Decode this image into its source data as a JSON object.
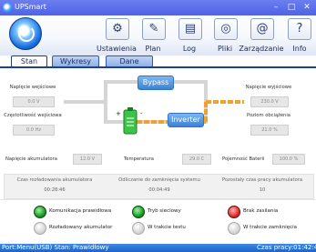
{
  "window": {
    "title": "UPSmart",
    "min": "–",
    "max": "□",
    "close": "✕"
  },
  "toolbar": {
    "items": [
      {
        "label": "Ustawienia",
        "icon": "settings-sliders-icon",
        "glyph": "⚙"
      },
      {
        "label": "Plan",
        "icon": "pencil-icon",
        "glyph": "✎"
      },
      {
        "label": "Log",
        "icon": "log-document-icon",
        "glyph": "▤"
      },
      {
        "label": "Pliki",
        "icon": "target-icon",
        "glyph": "◎"
      },
      {
        "label": "Zarządzanie",
        "icon": "at-icon",
        "glyph": "@"
      },
      {
        "label": "Info",
        "icon": "help-icon",
        "glyph": "?"
      }
    ]
  },
  "tabs": [
    {
      "label": "Stan",
      "active": true
    },
    {
      "label": "Wykresy",
      "active": false
    },
    {
      "label": "Dane",
      "active": false
    }
  ],
  "diagram": {
    "bypass": "Bypass",
    "inverter": "Inverter",
    "plus": "+",
    "minus": "-",
    "input_voltage_label": "Napięcie wejściowe",
    "input_voltage": "0.0 V",
    "input_freq_label": "Częstotliwość wejściowa",
    "input_freq": "0.0 Hz",
    "output_voltage_label": "Napięcie wyjściowe",
    "output_voltage": "230.0 V",
    "load_label": "Poziom obciążenia",
    "load": "21.0 %"
  },
  "battery": {
    "voltage_label": "Napięcie akumulatora",
    "voltage": "12.0 V",
    "temp_label": "Temperatura",
    "temp": "29.0 C",
    "capacity_label": "Pojemność Baterii",
    "capacity": "100.0 %"
  },
  "times": [
    {
      "label": "Czas rozładowania akumulatora",
      "value": "00:28:46"
    },
    {
      "label": "Odliczanie do zamknięcia systemu",
      "value": "00:04:49"
    },
    {
      "label": "Pozostały czas pracy akumulatora",
      "value": "10"
    }
  ],
  "indicators": [
    {
      "label": "Komunikacja prawidłowa",
      "state": "green"
    },
    {
      "label": "Tryb sieciowy",
      "state": "green"
    },
    {
      "label": "Brak zasilania",
      "state": "red"
    },
    {
      "label": "Rozładowany akumulator",
      "state": "gray"
    },
    {
      "label": "W trakcie testu",
      "state": "gray"
    },
    {
      "label": "W trakcie zamknięcia",
      "state": "gray"
    }
  ],
  "status": {
    "left": "Port:Menu(USB)  Stan: Prawidłowy",
    "right": "Czas pracy:01:42:4"
  },
  "colors": {
    "accent": "#1f3f9a",
    "line_orange": "#f2a22c",
    "line_gray": "#cfcfcf",
    "battery_green": "#3cc44a"
  }
}
